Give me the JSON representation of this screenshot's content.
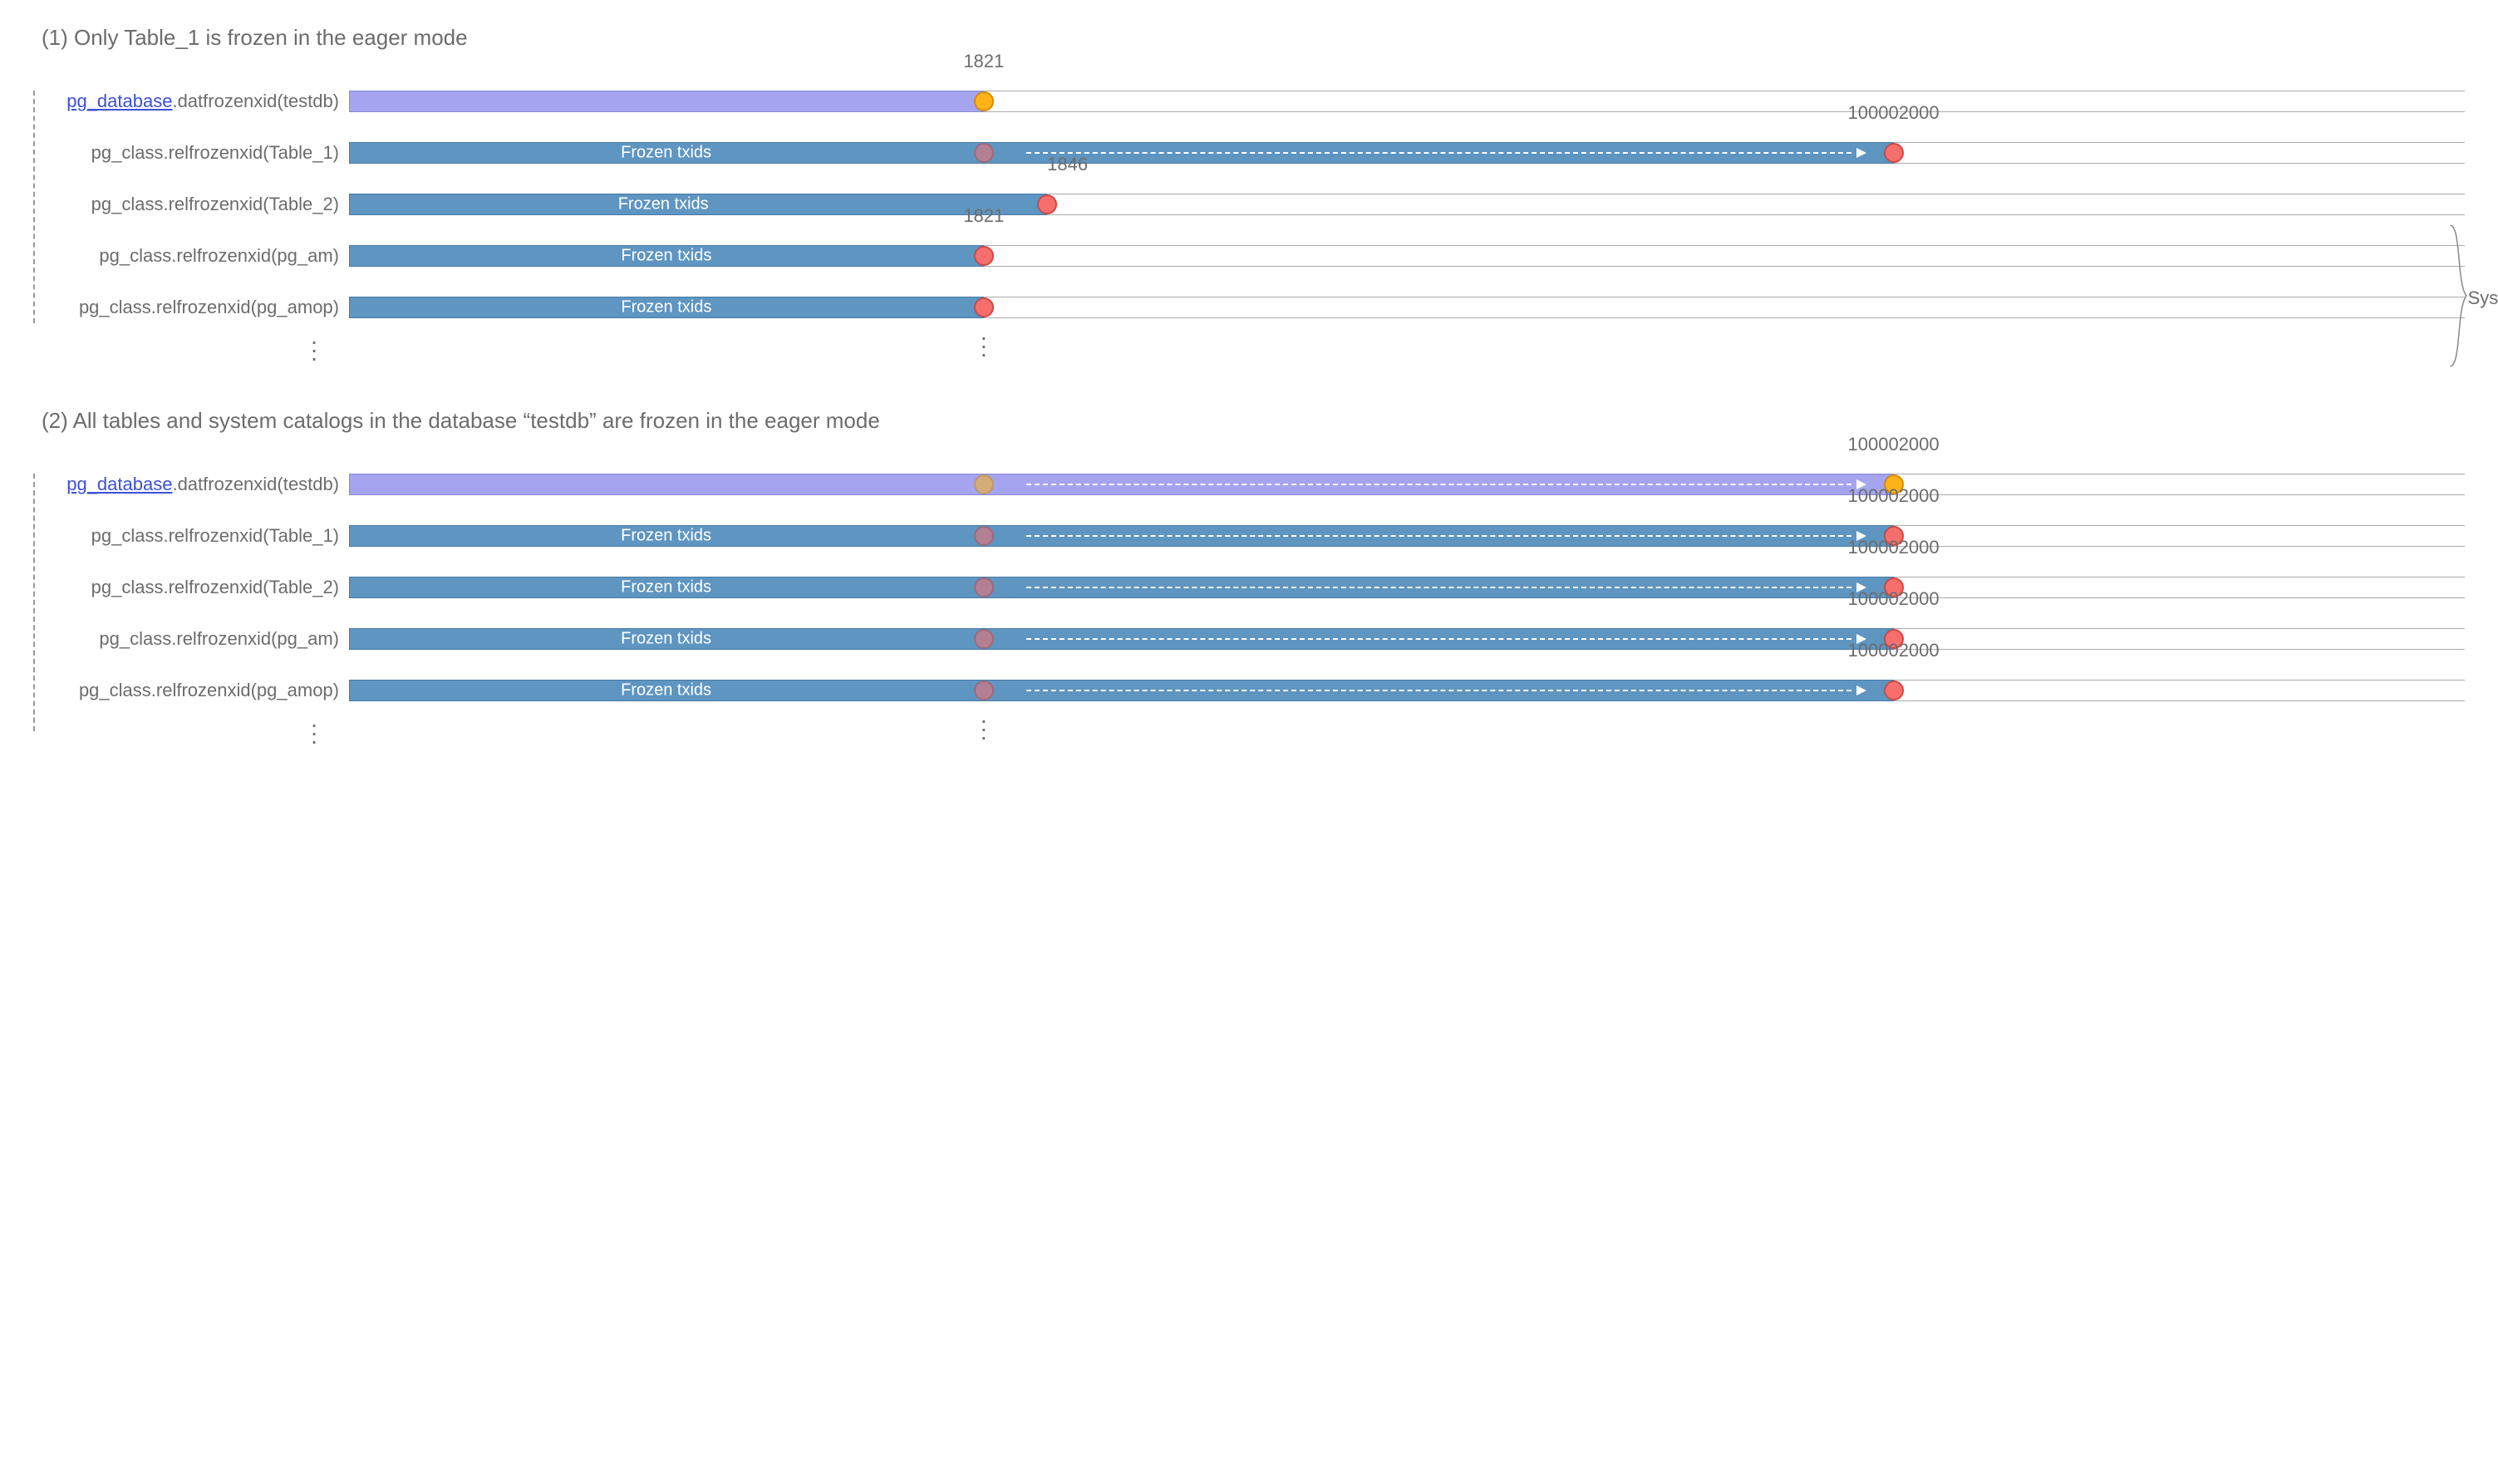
{
  "sections": {
    "s1": {
      "title": "(1) Only Table_1 is frozen in the eager mode",
      "datfrozenxid_value": "1821",
      "table1_target": "100002000",
      "table2_value": "1846",
      "pgam_value": "1821",
      "rows": {
        "db": {
          "link": "pg_database",
          "rest": ".datfrozenxid(testdb)"
        },
        "t1": {
          "text": "pg_class.relfrozenxid(Table_1)",
          "bar": "Frozen txids"
        },
        "t2": {
          "text": "pg_class.relfrozenxid(Table_2)",
          "bar": "Frozen txids"
        },
        "am": {
          "text": "pg_class.relfrozenxid(pg_am)",
          "bar": "Frozen txids"
        },
        "amop": {
          "text": "pg_class.relfrozenxid(pg_amop)",
          "bar": "Frozen txids"
        }
      },
      "brace_label": "System catalogs"
    },
    "s2": {
      "title": "(2) All tables and system catalogs in the database “testdb” are frozen in the eager mode",
      "target": "100002000",
      "rows": {
        "db": {
          "link": "pg_database",
          "rest": ".datfrozenxid(testdb)"
        },
        "t1": {
          "text": "pg_class.relfrozenxid(Table_1)",
          "bar": "Frozen txids"
        },
        "t2": {
          "text": "pg_class.relfrozenxid(Table_2)",
          "bar": "Frozen txids"
        },
        "am": {
          "text": "pg_class.relfrozenxid(pg_am)",
          "bar": "Frozen txids"
        },
        "amop": {
          "text": "pg_class.relfrozenxid(pg_amop)",
          "bar": "Frozen txids"
        }
      }
    }
  },
  "chart_data": {
    "type": "timeline-diagram",
    "description": "PostgreSQL frozen txid timelines for database and tables in eager freeze mode",
    "positions_pct": {
      "orig": 30,
      "table2": 33,
      "target": 73
    },
    "panel_1": {
      "pg_database.datfrozenxid(testdb)": 1821,
      "pg_class.relfrozenxid(Table_1)": 100002000,
      "pg_class.relfrozenxid(Table_2)": 1846,
      "pg_class.relfrozenxid(pg_am)": 1821,
      "pg_class.relfrozenxid(pg_amop)": 1821
    },
    "panel_2": {
      "pg_database.datfrozenxid(testdb)": 100002000,
      "pg_class.relfrozenxid(Table_1)": 100002000,
      "pg_class.relfrozenxid(Table_2)": 100002000,
      "pg_class.relfrozenxid(pg_am)": 100002000,
      "pg_class.relfrozenxid(pg_amop)": 100002000
    },
    "colors": {
      "db_bar": "#a5a4ee",
      "table_bar": "#5f95c1",
      "db_dot": "#fdb318",
      "table_dot": "#f66f6c"
    }
  }
}
